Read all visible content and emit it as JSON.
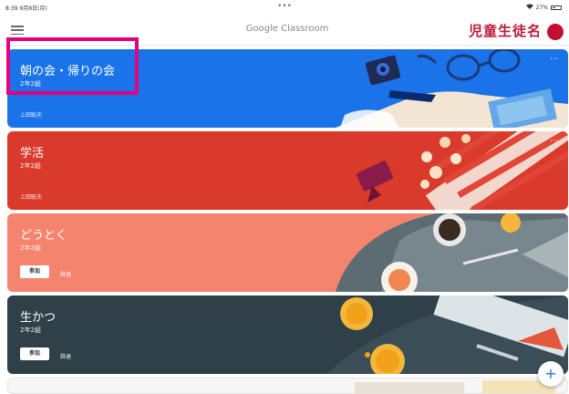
{
  "status": {
    "time": "8:39",
    "date": "9月8日(月)",
    "dots": "•••",
    "battery_pct": "27%"
  },
  "appbar": {
    "title": "Google Classroom",
    "student_name": "児童生徒名"
  },
  "cards": [
    {
      "title": "朝の会・帰りの会",
      "section": "2年2組",
      "owner": "上田聡夫",
      "more": "⋯",
      "color": "#1a73e8"
    },
    {
      "title": "学活",
      "section": "2年2組",
      "owner": "上田聡夫",
      "more": "⋯",
      "color": "#d93a2b"
    },
    {
      "title": "どうとく",
      "section": "2年2組",
      "join": "参加",
      "decline": "辞退",
      "color": "#f4846d"
    },
    {
      "title": "生かつ",
      "section": "2年2組",
      "join": "参加",
      "decline": "辞退",
      "color": "#2f4049"
    }
  ],
  "fab": {
    "label": "+"
  }
}
